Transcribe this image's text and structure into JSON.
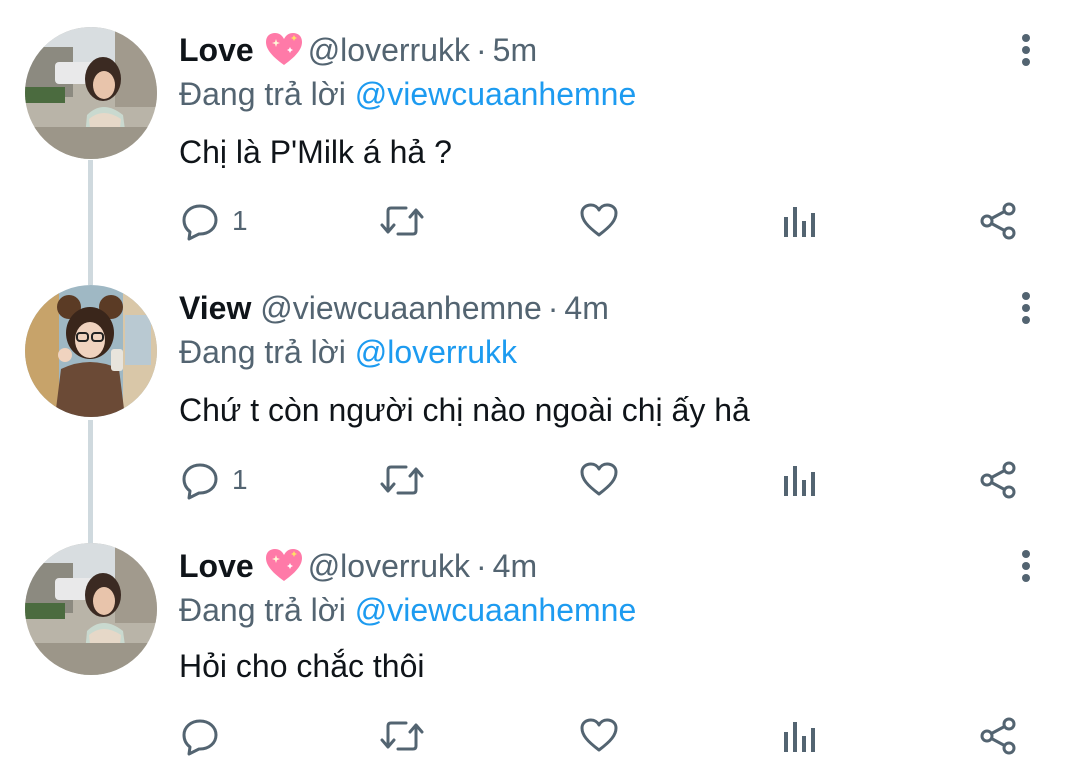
{
  "tweets": [
    {
      "name": "Love",
      "name_emoji": "sparkling-heart-emoji",
      "handle": "@loverrukk",
      "separator": "·",
      "time": "5m",
      "reply_prefix": "Đang trả lời",
      "reply_to": "@viewcuaanhemne",
      "text": "Chị là P'Milk á hả ?",
      "reply_count": "1"
    },
    {
      "name": "View",
      "handle": "@viewcuaanhemne",
      "separator": "·",
      "time": "4m",
      "reply_prefix": "Đang trả lời",
      "reply_to": "@loverrukk",
      "text": "Chứ t còn người chị nào ngoài chị ấy hả",
      "reply_count": "1"
    },
    {
      "name": "Love",
      "name_emoji": "sparkling-heart-emoji",
      "handle": "@loverrukk",
      "separator": "·",
      "time": "4m",
      "reply_prefix": "Đang trả lời",
      "reply_to": "@viewcuaanhemne",
      "text": "Hỏi cho chắc thôi",
      "reply_count": ""
    }
  ],
  "icons": {
    "reply": "reply-icon",
    "retweet": "retweet-icon",
    "like": "heart-icon",
    "views": "analytics-icon",
    "share": "share-icon",
    "more": "more-vertical-icon"
  },
  "colors": {
    "link": "#1d9bf0",
    "secondary_text": "#536471",
    "primary_text": "#0f1419",
    "thread_line": "#cfd9de",
    "emoji": "#ff7aa8"
  }
}
